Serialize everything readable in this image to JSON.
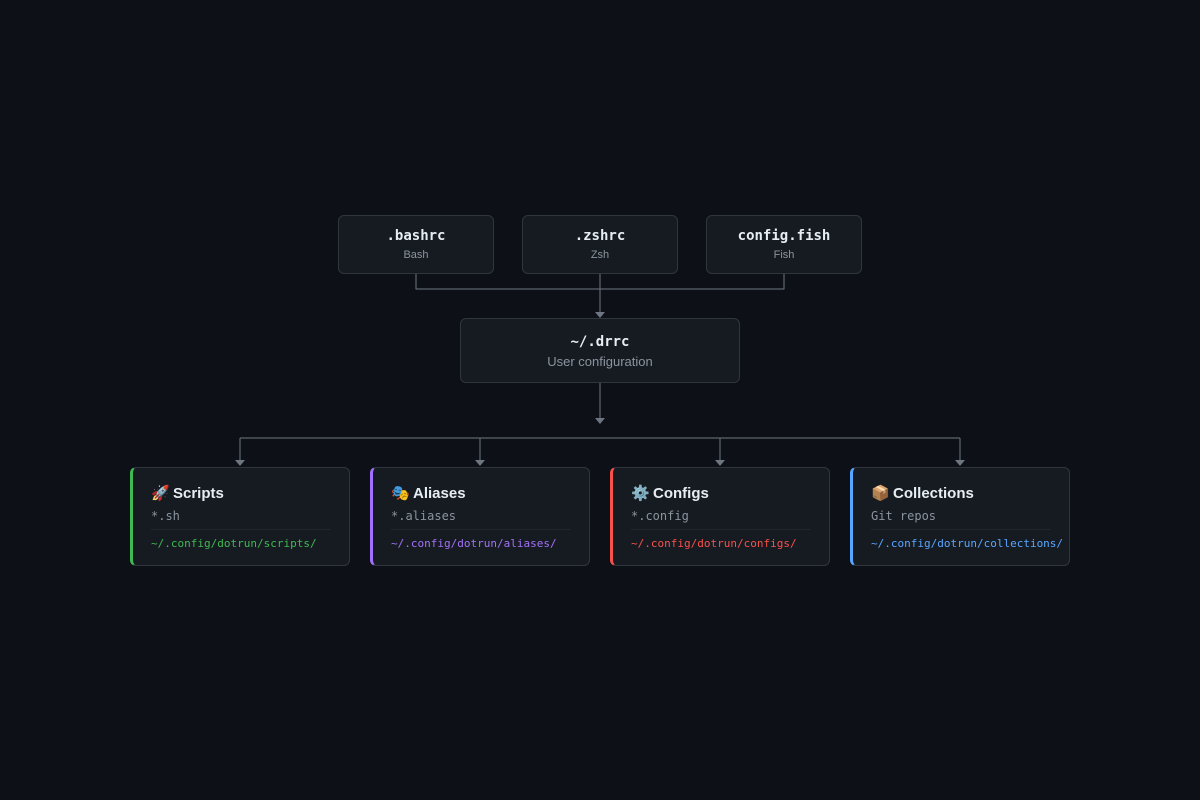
{
  "colors": {
    "background": "#0d1117",
    "node_bg": "#161b22",
    "node_border": "#30363d",
    "connector": "#6e7681",
    "scripts": "#3fb950",
    "aliases": "#a371f7",
    "configs": "#f85149",
    "collections": "#58a6ff"
  },
  "shells": [
    {
      "file": ".bashrc",
      "label": "Bash"
    },
    {
      "file": ".zshrc",
      "label": "Zsh"
    },
    {
      "file": "config.fish",
      "label": "Fish"
    }
  ],
  "drrc": {
    "file": "~/.drrc",
    "label": "User configuration"
  },
  "cards": [
    {
      "emoji": "🚀",
      "icon": "rocket-icon",
      "name": "Scripts",
      "pattern": "*.sh",
      "path": "~/.config/dotrun/scripts/",
      "color": "#3fb950"
    },
    {
      "emoji": "🎭",
      "icon": "theater-masks-icon",
      "name": "Aliases",
      "pattern": "*.aliases",
      "path": "~/.config/dotrun/aliases/",
      "color": "#a371f7"
    },
    {
      "emoji": "⚙️",
      "icon": "gear-icon",
      "name": "Configs",
      "pattern": "*.config",
      "path": "~/.config/dotrun/configs/",
      "color": "#f85149"
    },
    {
      "emoji": "📦",
      "icon": "package-icon",
      "name": "Collections",
      "pattern": "Git repos",
      "path": "~/.config/dotrun/collections/",
      "color": "#58a6ff"
    }
  ]
}
